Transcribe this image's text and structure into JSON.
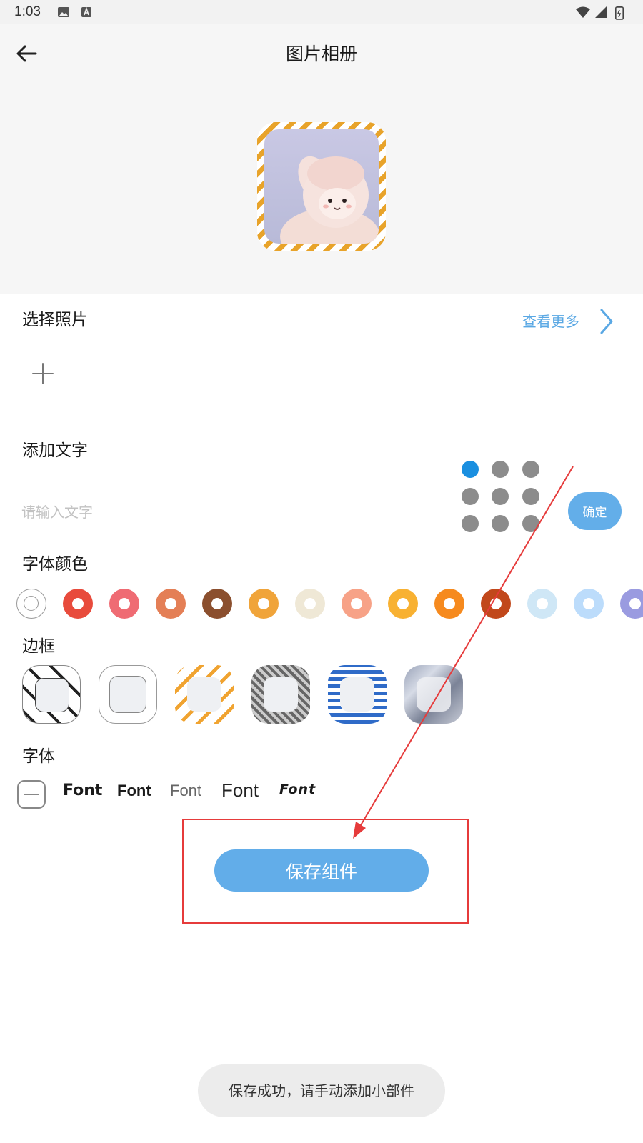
{
  "status_bar": {
    "time": "1:03",
    "left_icons": [
      "image-icon",
      "text-a-icon"
    ],
    "right_icons": [
      "wifi-icon",
      "signal-icon",
      "battery-icon"
    ]
  },
  "header": {
    "title": "图片相册",
    "back_icon": "arrow-left-icon"
  },
  "select_photo": {
    "title": "选择照片",
    "more_label": "查看更多",
    "add_icon": "plus-icon"
  },
  "add_text": {
    "title": "添加文字",
    "placeholder": "请输入文字",
    "value": "",
    "position_selected": 0,
    "confirm_label": "确定"
  },
  "font_color": {
    "title": "字体颜色",
    "colors": [
      "#ffffff",
      "#e84b3c",
      "#ef6b73",
      "#e47f56",
      "#8b4f2e",
      "#f0a43a",
      "#efe8d6",
      "#f7a287",
      "#f8b132",
      "#f68a1e",
      "#c1481b",
      "#cfe7f6",
      "#bcdcfb",
      "#9a9be0"
    ]
  },
  "border": {
    "title": "边框",
    "options": [
      "black-diagonal-stripe-frame",
      "plain-gray-frame",
      "orange-diagonal-stripe-frame",
      "gray-plaid-frame",
      "blue-gingham-frame",
      "gray-blue-photo-frame"
    ]
  },
  "font": {
    "title": "字体",
    "none_icon": "minus-box-icon",
    "options": [
      "Font",
      "Font",
      "Font",
      "Font",
      "Font"
    ]
  },
  "save_button": "保存组件",
  "toast": "保存成功，请手动添加小部件",
  "colors": {
    "accent": "#62ade9",
    "link": "#5aa8e4",
    "annotation": "#e63b3b"
  }
}
